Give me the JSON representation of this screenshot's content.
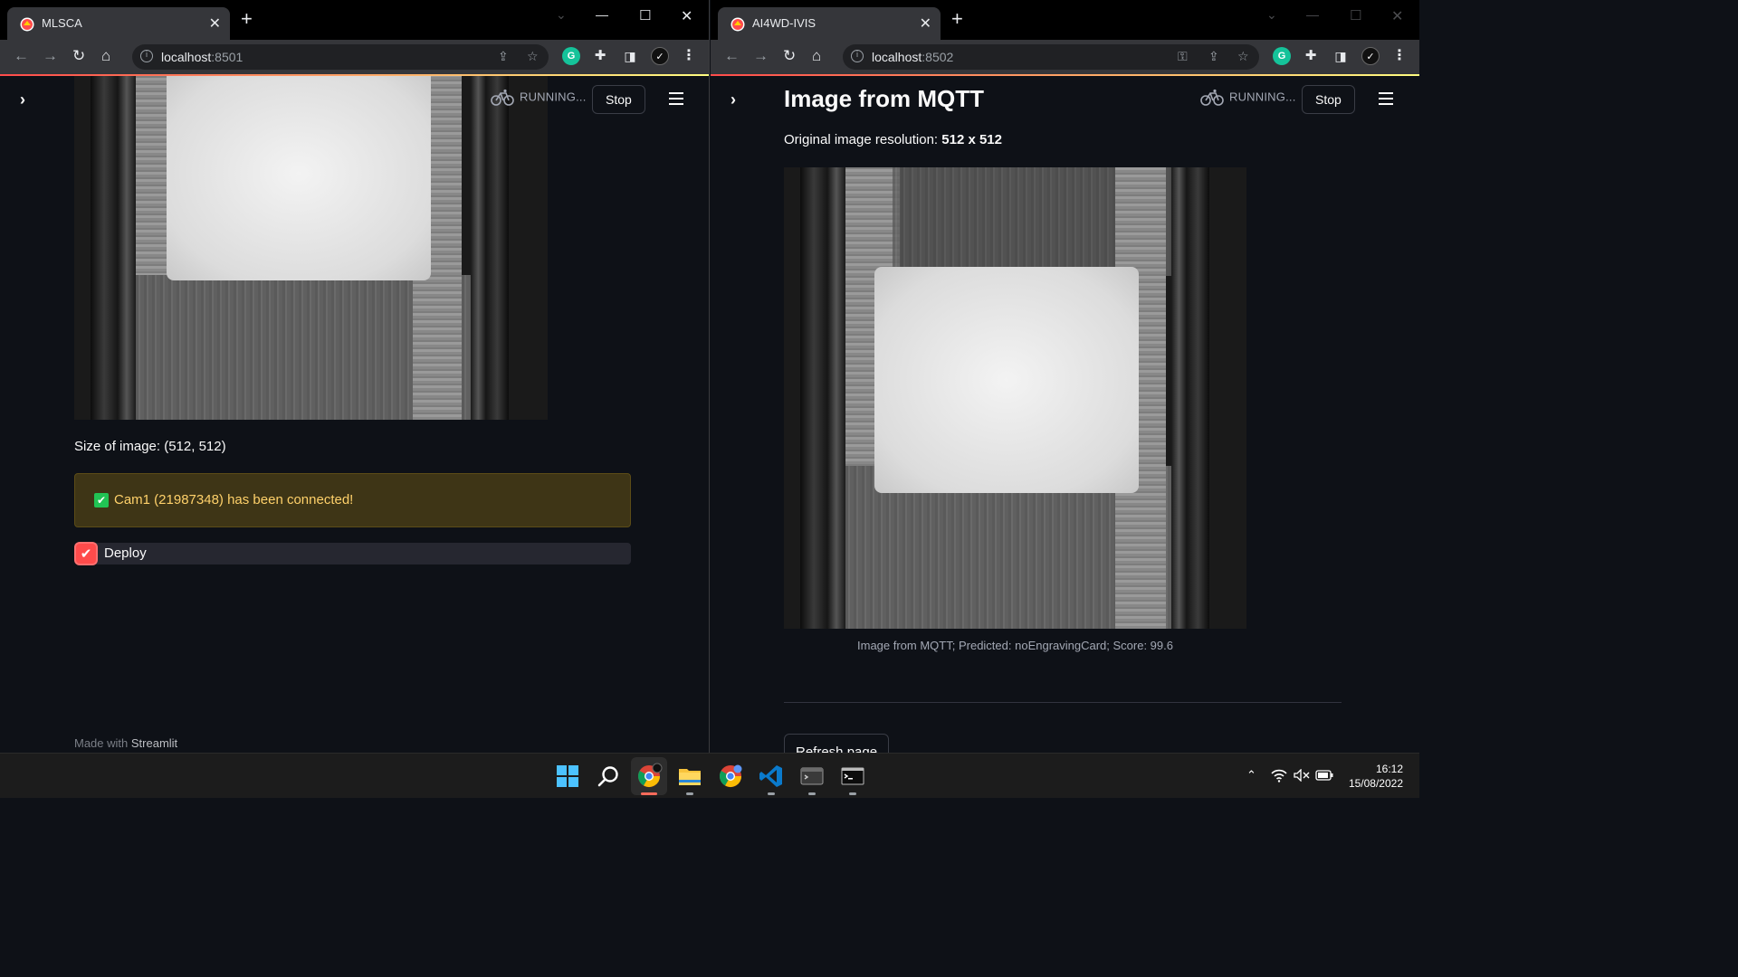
{
  "left_window": {
    "tab_title": "MLSCA",
    "url_host": "localhost",
    "url_port": ":8501",
    "status_text": "RUNNING...",
    "stop_label": "Stop",
    "size_text": "Size of image: (512, 512)",
    "alert_text": "Cam1 (21987348) has been connected!",
    "deploy_label": "Deploy",
    "deploy_checked": true,
    "footer_prefix": "Made with ",
    "footer_brand": "Streamlit"
  },
  "right_window": {
    "tab_title": "AI4WD-IVIS",
    "url_host": "localhost",
    "url_port": ":8502",
    "status_text": "RUNNING...",
    "stop_label": "Stop",
    "heading": "Image from MQTT",
    "resolution_prefix": "Original image resolution: ",
    "resolution_value": "512 x 512",
    "caption": "Image from MQTT; Predicted: noEngravingCard; Score: 99.6",
    "refresh_label": "Refresh page"
  },
  "taskbar": {
    "apps": [
      "start-icon",
      "search-icon",
      "chrome-icon",
      "file-explorer-icon",
      "chrome-canary-icon",
      "vscode-icon",
      "terminal-icon",
      "command-prompt-icon"
    ],
    "time": "16:12",
    "date": "15/08/2022"
  },
  "colors": {
    "accent_red": "#ff4b4b",
    "alert_bg": "#3e3516",
    "alert_text": "#ffd16a",
    "success_green": "#21c354",
    "app_bg": "#0e1117"
  }
}
